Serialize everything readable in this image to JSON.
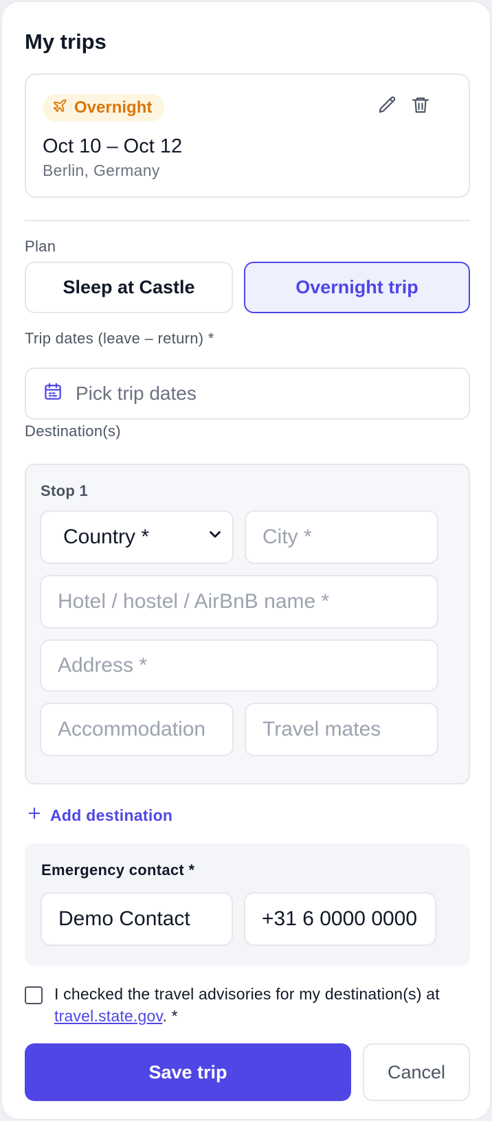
{
  "page": {
    "title": "My trips"
  },
  "trip_card": {
    "badge": "Overnight",
    "badge_icon": "plane-icon",
    "dates": "Oct 10 – Oct 12",
    "location": "Berlin, Germany",
    "actions": [
      "edit-icon",
      "trash-icon"
    ]
  },
  "plan": {
    "label": "Plan",
    "options": [
      "Sleep at Castle",
      "Overnight trip"
    ],
    "selected": "Overnight trip"
  },
  "trip_dates": {
    "label": "Trip dates (leave – return) *",
    "placeholder": "Pick trip dates",
    "icon": "calendar-icon"
  },
  "destinations": {
    "label": "Destination(s)",
    "stop": {
      "title": "Stop 1",
      "country_value": "Country *",
      "city_placeholder": "City *",
      "hotel_placeholder": "Hotel / hostel / AirBnB name *",
      "address_placeholder": "Address *",
      "accommodation_placeholder": "Accommodation",
      "travel_mates_placeholder": "Travel mates"
    },
    "add_label": "Add destination"
  },
  "emergency": {
    "title": "Emergency contact *",
    "name_value": "Demo Contact",
    "phone_value": "+31 6 0000 0000"
  },
  "advisory": {
    "text_before": "I checked the travel advisories for my destination(s) at ",
    "link_text": "travel.state.gov",
    "text_after": ". *"
  },
  "actions": {
    "save_label": "Save trip",
    "cancel_label": "Cancel"
  },
  "colors": {
    "accent": "#4f46e5",
    "badge_text": "#d97706",
    "badge_bg": "#fef5e1",
    "border": "#e5e7eb"
  }
}
